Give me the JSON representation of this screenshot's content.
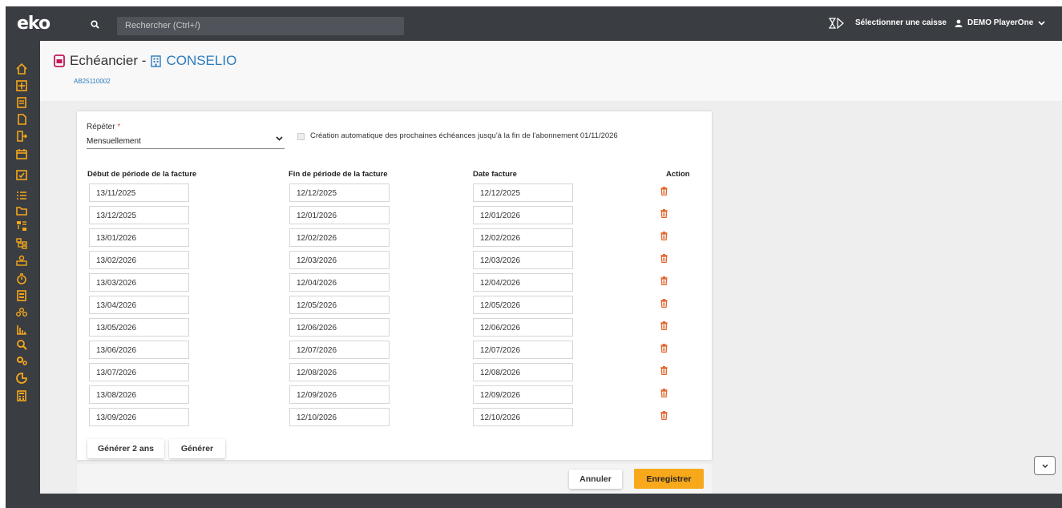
{
  "topbar": {
    "logo": "eko",
    "search_placeholder": "Rechercher (Ctrl+/)",
    "caisse_label": "Sélectionner une caisse",
    "user_label": "DEMO PlayerOne"
  },
  "sidebar": {
    "items": [
      "home-icon",
      "dashboard-icon",
      "list-icon",
      "document-icon",
      "export-document-icon",
      "calendar-icon",
      "calendar-check-icon",
      "tasks-icon",
      "folder-icon",
      "workflow-icon",
      "hierarchy-icon",
      "contacts-icon",
      "timer-icon",
      "form-icon",
      "group-icon",
      "stats-icon",
      "search-icon",
      "settings-icon",
      "palette-icon",
      "calculator-icon"
    ]
  },
  "header": {
    "title": "Echéancier -",
    "client": "CONSELIO",
    "ref": "AB25110002"
  },
  "form": {
    "repeat_label": "Répéter",
    "repeat_required": "*",
    "repeat_value": "Mensuellement",
    "auto_label": "Création automatique des prochaines échéances jusqu'à la fin de l'abonnement 01/11/2026",
    "columns": {
      "start": "Début de période de la facture",
      "end": "Fin de période de la facture",
      "date": "Date facture",
      "action": "Action"
    },
    "rows": [
      {
        "start": "13/11/2025",
        "end": "12/12/2025",
        "date": "12/12/2025"
      },
      {
        "start": "13/12/2025",
        "end": "12/01/2026",
        "date": "12/01/2026"
      },
      {
        "start": "13/01/2026",
        "end": "12/02/2026",
        "date": "12/02/2026"
      },
      {
        "start": "13/02/2026",
        "end": "12/03/2026",
        "date": "12/03/2026"
      },
      {
        "start": "13/03/2026",
        "end": "12/04/2026",
        "date": "12/04/2026"
      },
      {
        "start": "13/04/2026",
        "end": "12/05/2026",
        "date": "12/05/2026"
      },
      {
        "start": "13/05/2026",
        "end": "12/06/2026",
        "date": "12/06/2026"
      },
      {
        "start": "13/06/2026",
        "end": "12/07/2026",
        "date": "12/07/2026"
      },
      {
        "start": "13/07/2026",
        "end": "12/08/2026",
        "date": "12/08/2026"
      },
      {
        "start": "13/08/2026",
        "end": "12/09/2026",
        "date": "12/09/2026"
      },
      {
        "start": "13/09/2026",
        "end": "12/10/2026",
        "date": "12/10/2026"
      }
    ],
    "generate_2y_label": "Générer 2 ans",
    "generate_label": "Générer"
  },
  "footer": {
    "cancel_label": "Annuler",
    "save_label": "Enregistrer"
  },
  "colors": {
    "bar": "#3a3d41",
    "accent": "#f7a81b",
    "link": "#2b7bbd",
    "sidebar_icon": "#f7a81b",
    "delete_icon": "#e0632a",
    "title_icon": "#c2185b"
  }
}
